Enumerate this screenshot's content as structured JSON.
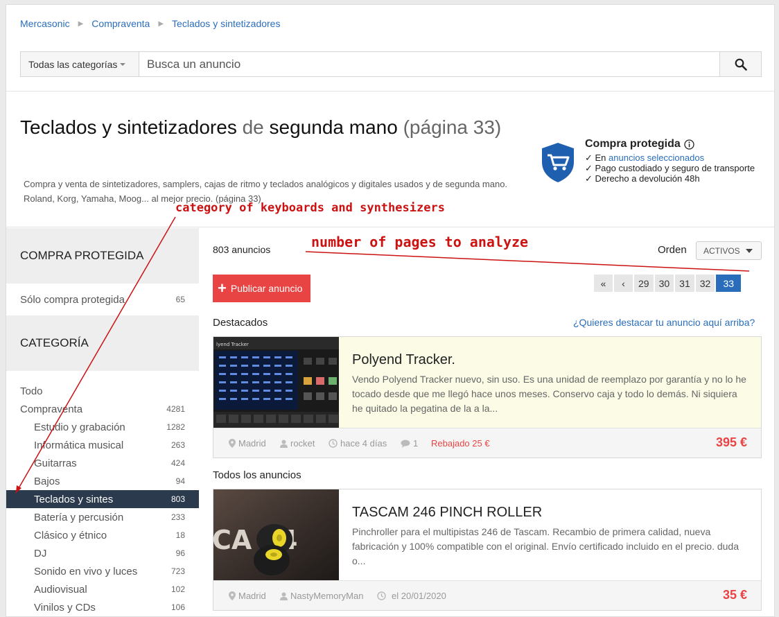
{
  "breadcrumb": {
    "items": [
      "Mercasonic",
      "Compraventa",
      "Teclados y sintetizadores"
    ]
  },
  "search": {
    "category_label": "Todas las categorías",
    "placeholder": "Busca un anuncio"
  },
  "header": {
    "title_main": "Teclados y sintetizadores",
    "title_de": "de",
    "title_rest": "segunda mano",
    "title_page": "(página 33)",
    "description": "Compra y venta de sintetizadores, samplers, cajas de ritmo y teclados analógicos y digitales usados y de segunda mano. Roland, Korg, Yamaha, Moog... al mejor precio. (página 33)"
  },
  "protection": {
    "title": "Compra protegida",
    "line1_prefix": "✓ En",
    "line1_link": "anuncios seleccionados",
    "line2": "✓ Pago custodiado y seguro de transporte",
    "line3": "✓ Derecho a devolución 48h",
    "shield_color": "#1f5fb0"
  },
  "annotations": {
    "category": "category of keyboards and synthesizers",
    "pages": "number of pages to analyze"
  },
  "sidebar": {
    "protected_heading": "COMPRA PROTEGIDA",
    "protected_item": {
      "label": "Sólo compra protegida",
      "count": "65"
    },
    "category_heading": "CATEGORÍA",
    "items": [
      {
        "label": "Todo",
        "count": ""
      },
      {
        "label": "Compraventa",
        "count": "4281"
      },
      {
        "label": "Estudio y grabación",
        "count": "1282"
      },
      {
        "label": "Informática musical",
        "count": "263"
      },
      {
        "label": "Guitarras",
        "count": "424"
      },
      {
        "label": "Bajos",
        "count": "94"
      },
      {
        "label": "Teclados y sintes",
        "count": "803"
      },
      {
        "label": "Batería y percusión",
        "count": "233"
      },
      {
        "label": "Clásico y étnico",
        "count": "18"
      },
      {
        "label": "DJ",
        "count": "96"
      },
      {
        "label": "Sonido en vivo y luces",
        "count": "723"
      },
      {
        "label": "Audiovisual",
        "count": "102"
      },
      {
        "label": "Vinilos y CDs",
        "count": "106"
      }
    ]
  },
  "listing": {
    "count": "803 anuncios",
    "orden_label": "Orden",
    "orden_value": "ACTIVOS",
    "publish_label": "Publicar anuncio",
    "pagination": [
      "«",
      "‹",
      "29",
      "30",
      "31",
      "32",
      "33"
    ],
    "current_page": "33",
    "featured_label": "Destacados",
    "featured_link": "¿Quieres destacar tu anuncio aquí arriba?",
    "all_label": "Todos los anuncios"
  },
  "ads": [
    {
      "title": "Polyend Tracker.",
      "text": "Vendo Polyend Tracker nuevo, sin uso. Es una unidad de reemplazo por garantía y no lo he tocado desde que me llegó hace unos meses. Conservo caja y todo lo demás. Ni siquiera he quitado la pegatina de la a la...",
      "location": "Madrid",
      "user": "rocket",
      "time": "hace 4 días",
      "comments": "1",
      "discount": "Rebajado 25 €",
      "price": "395 €",
      "thumb_text": "lyend Tracker"
    },
    {
      "title": "TASCAM 246 PINCH ROLLER",
      "text": "Pinchroller para el multipistas 246 de Tascam. Recambio de primera calidad, nueva fabricación y 100% compatible con el original. Envío certificado incluido en el precio. duda o...",
      "location": "Madrid",
      "user": "NastyMemoryMan",
      "time": "el 20/01/2020",
      "price": "35 €",
      "thumb_text": "CA 24"
    }
  ]
}
